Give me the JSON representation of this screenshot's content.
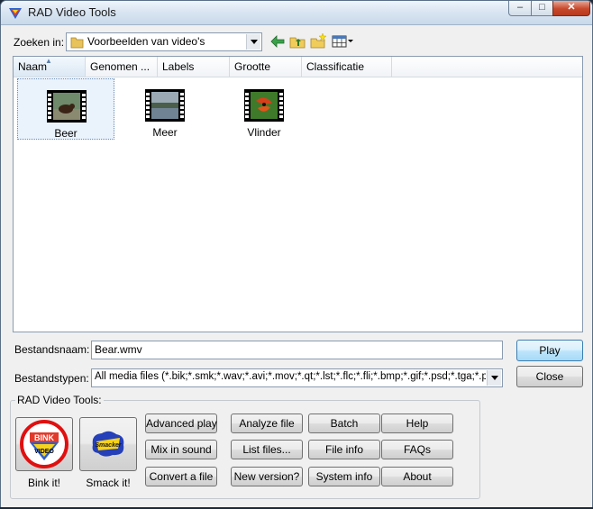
{
  "window": {
    "title": "RAD Video Tools",
    "minimize": "–",
    "maximize": "□",
    "close": "✕"
  },
  "lookin": {
    "label": "Zoeken in:",
    "value": "Voorbeelden van video's"
  },
  "toolbar": {
    "back_icon": "back-arrow-icon",
    "up_icon": "up-folder-icon",
    "new_folder_icon": "new-folder-icon",
    "views_icon": "views-menu-icon"
  },
  "columns": [
    "Naam",
    "Genomen ...",
    "Labels",
    "Grootte",
    "Classificatie"
  ],
  "files": [
    {
      "name": "Beer",
      "selected": true
    },
    {
      "name": "Meer",
      "selected": false
    },
    {
      "name": "Vlinder",
      "selected": false
    }
  ],
  "filename": {
    "label": "Bestandsnaam:",
    "value": "Bear.wmv"
  },
  "filetypes": {
    "label": "Bestandstypen:",
    "value": "All media files (*.bik;*.smk;*.wav;*.avi;*.mov;*.qt;*.lst;*.flc;*.fli;*.bmp;*.gif;*.psd;*.tga;*.pcx;*.tif"
  },
  "buttons": {
    "play": "Play",
    "close": "Close"
  },
  "tools_group": {
    "title": "RAD Video Tools:",
    "bink_label": "Bink it!",
    "smack_label": "Smack it!",
    "bink_logo": "BINK VIDEO",
    "smack_logo": "Smacker",
    "grid": [
      [
        "Advanced play",
        "Analyze file",
        "Batch",
        "Help"
      ],
      [
        "Mix in sound",
        "List files...",
        "File info",
        "FAQs"
      ],
      [
        "Convert a file",
        "New version?",
        "System info",
        "About"
      ]
    ]
  },
  "colors": {
    "accent": "#3c7fb1",
    "bink_ring": "#e01010",
    "selection": "#eaf2fb"
  }
}
